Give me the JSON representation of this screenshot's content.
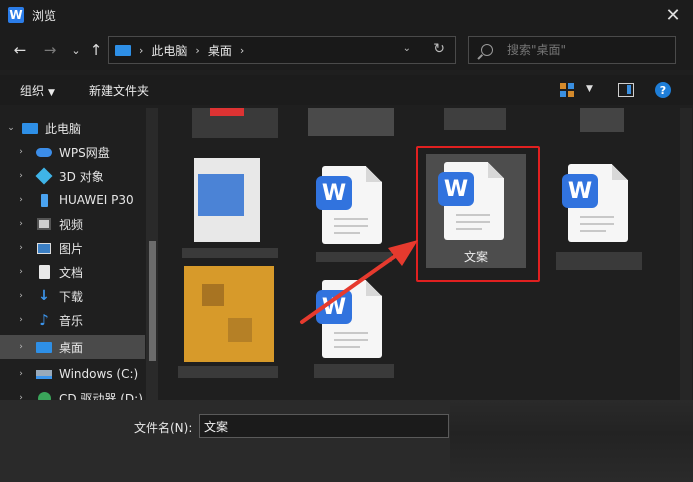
{
  "window": {
    "title": "浏览",
    "app_icon_letter": "W"
  },
  "nav": {
    "back": "←",
    "forward": "→",
    "recent": "⌄",
    "up": "↑",
    "address": [
      "此电脑",
      "桌面"
    ],
    "search_placeholder": "搜索\"桌面\""
  },
  "toolbar": {
    "organize": "组织",
    "new_folder": "新建文件夹"
  },
  "sidebar": {
    "items": [
      {
        "label": "此电脑",
        "icon": "computer-icon"
      },
      {
        "label": "WPS网盘",
        "icon": "cloud-icon"
      },
      {
        "label": "3D 对象",
        "icon": "cube-icon"
      },
      {
        "label": "HUAWEI P30",
        "icon": "phone-icon"
      },
      {
        "label": "视频",
        "icon": "video-icon"
      },
      {
        "label": "图片",
        "icon": "image-icon"
      },
      {
        "label": "文档",
        "icon": "document-icon"
      },
      {
        "label": "下载",
        "icon": "download-icon"
      },
      {
        "label": "音乐",
        "icon": "music-icon"
      },
      {
        "label": "桌面",
        "icon": "desktop-icon"
      },
      {
        "label": "Windows (C:)",
        "icon": "drive-icon"
      },
      {
        "label": "CD 驱动器 (D:)",
        "icon": "cd-drive-icon"
      }
    ]
  },
  "files": {
    "selected_label": "文案",
    "wps_letter": "W"
  },
  "bottom": {
    "filename_label": "文件名(N):",
    "filename_value": "文案"
  },
  "colors": {
    "accent": "#3173de",
    "highlight": "#e02020",
    "arrow": "#e63a2e"
  }
}
